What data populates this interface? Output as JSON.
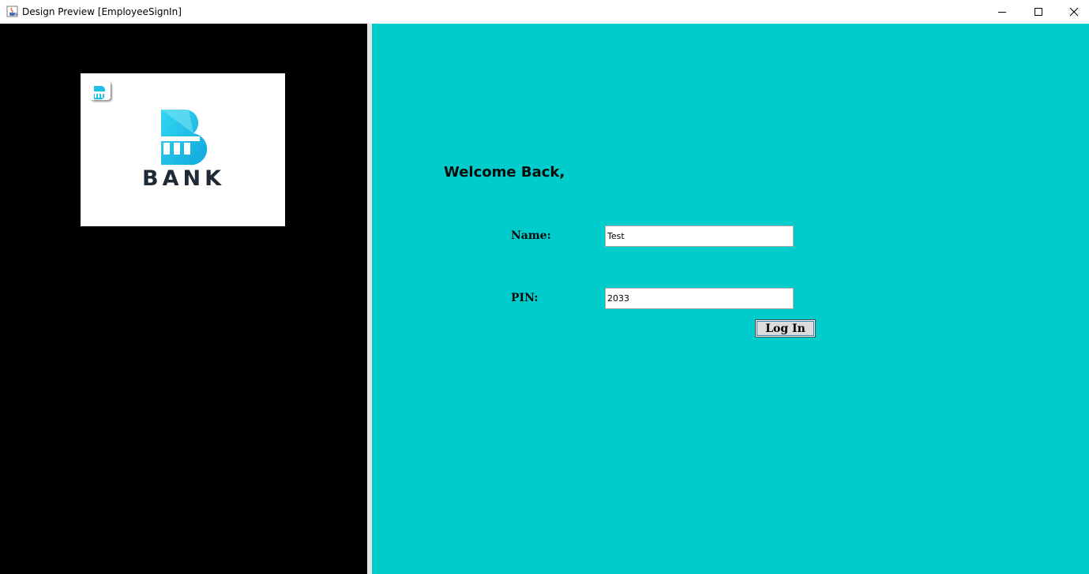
{
  "window": {
    "title": "Design Preview [EmployeeSignIn]",
    "icons": {
      "app": "java-app-icon",
      "minimize": "minimize-icon",
      "maximize": "maximize-icon",
      "close": "close-icon"
    }
  },
  "logo": {
    "word": "BANK",
    "icon": "bank-building-icon",
    "brand_color": "#1ec0e8",
    "text_color": "#1e2a36"
  },
  "colors": {
    "left_panel": "#000000",
    "right_panel": "#00cccc",
    "divider": "#e6e6e6"
  },
  "form": {
    "heading": "Welcome Back,",
    "name_label": "Name:",
    "name_value": "Test",
    "pin_label": "PIN:",
    "pin_value": "2033",
    "login_label": "Log In"
  }
}
